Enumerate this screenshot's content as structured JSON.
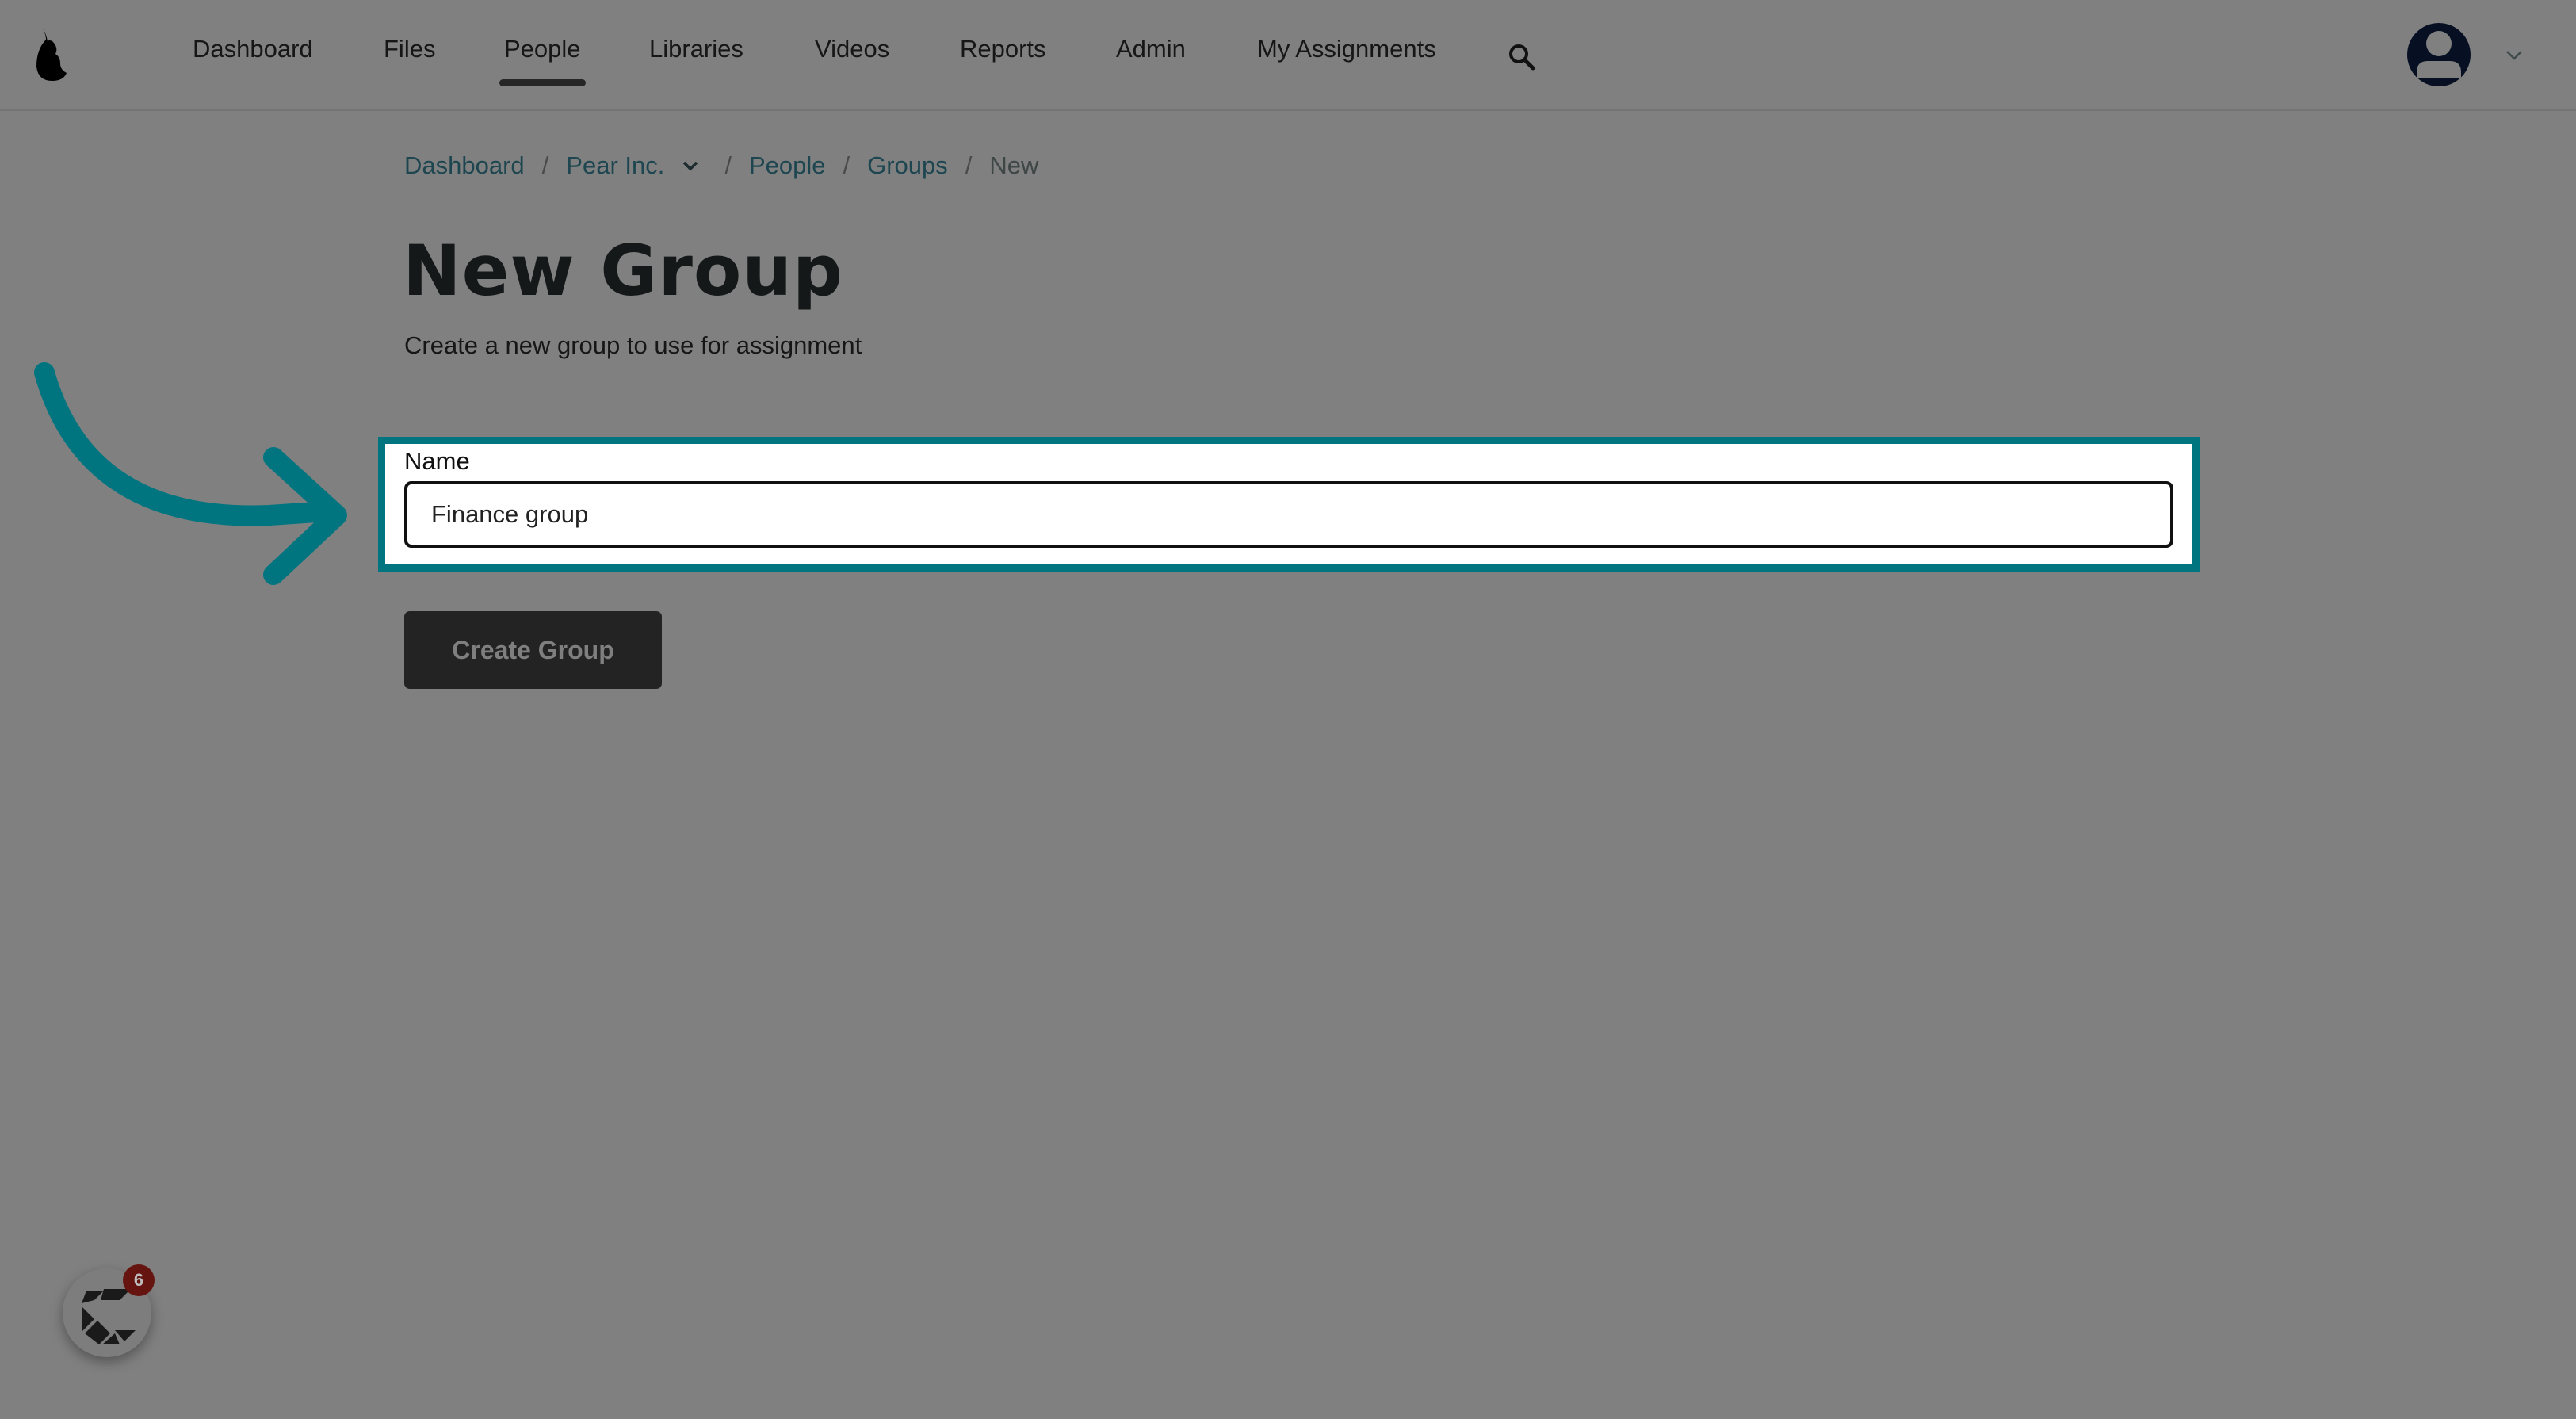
{
  "nav": {
    "items": [
      {
        "label": "Dashboard"
      },
      {
        "label": "Files"
      },
      {
        "label": "People",
        "active": true
      },
      {
        "label": "Libraries"
      },
      {
        "label": "Videos"
      },
      {
        "label": "Reports"
      },
      {
        "label": "Admin"
      },
      {
        "label": "My Assignments"
      }
    ],
    "icons": {
      "logo": "pear-logo",
      "search": "search-icon",
      "avatar": "user-avatar-icon",
      "menu": "chevron-down-icon"
    }
  },
  "breadcrumb": [
    {
      "label": "Dashboard"
    },
    {
      "label": "Pear Inc.",
      "dropdown": true
    },
    {
      "label": "People"
    },
    {
      "label": "Groups"
    },
    {
      "label": "New"
    }
  ],
  "breadcrumb_sep": "/",
  "page": {
    "title": "New Group",
    "subtitle": "Create a new group to use for assignment"
  },
  "form": {
    "name_label": "Name",
    "name_value": "Finance group",
    "submit_label": "Create Group"
  },
  "widget": {
    "badge_count": "6"
  },
  "colors": {
    "highlight": "#007580",
    "overlay": "#808080",
    "button": "#232323",
    "badge": "#661410"
  }
}
